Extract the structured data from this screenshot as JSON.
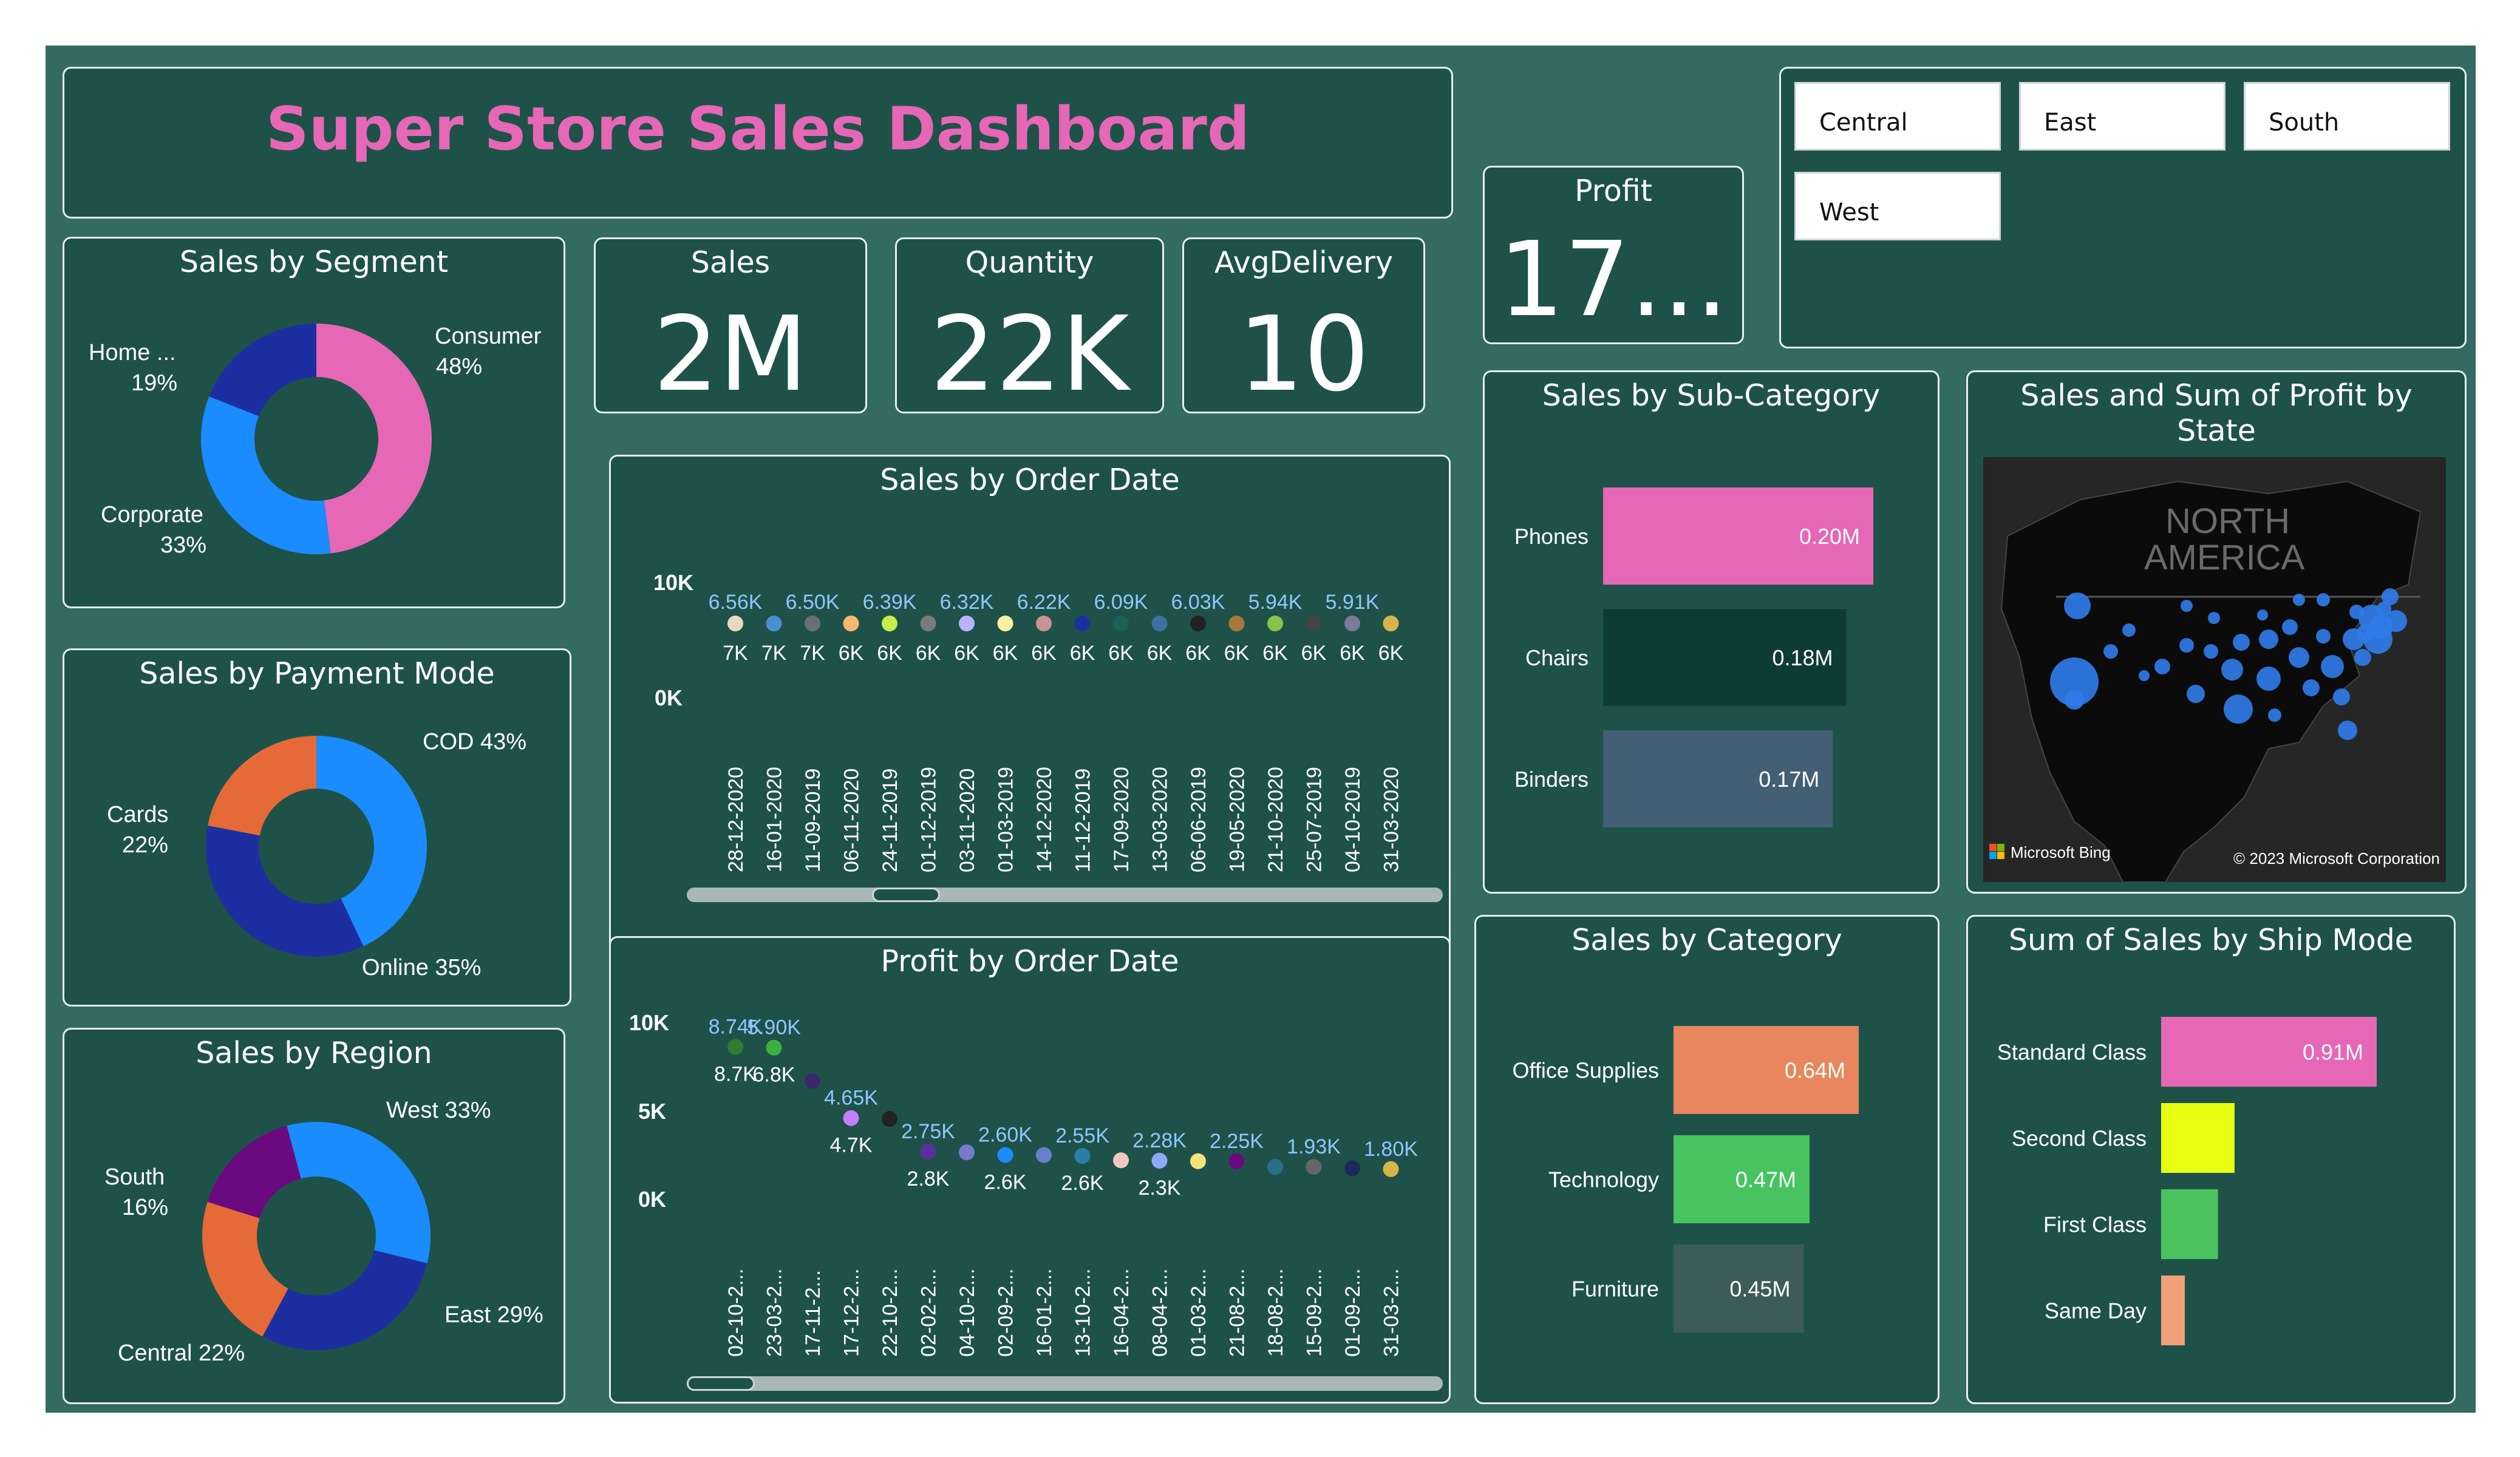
{
  "header": {
    "title": "Super Store Sales Dashboard"
  },
  "kpis": {
    "profit": {
      "label": "Profit",
      "value": "17..."
    },
    "sales": {
      "label": "Sales",
      "value": "2M"
    },
    "quantity": {
      "label": "Quantity",
      "value": "22K"
    },
    "avg_delivery": {
      "label": "AvgDelivery",
      "value": "10"
    }
  },
  "slicer": {
    "items": [
      "Central",
      "East",
      "South",
      "West"
    ]
  },
  "colors": {
    "canvas": "#336a62",
    "card": "#1e5249",
    "accent_pink": "#e667b5",
    "blue": "#1a8cff",
    "navy": "#1d2fa0",
    "orange": "#e56a38"
  },
  "segment": {
    "title": "Sales by Segment",
    "slices": [
      {
        "label": "Consumer",
        "pct": "48%",
        "value": 48,
        "color": "#e667b5"
      },
      {
        "label": "Corporate",
        "pct": "33%",
        "value": 33,
        "color": "#1a8cff"
      },
      {
        "label": "Home ...",
        "pct": "19%",
        "value": 19,
        "color": "#1d2fa0"
      }
    ]
  },
  "payment": {
    "title": "Sales by Payment Mode",
    "slices": [
      {
        "label": "COD 43%",
        "value": 43,
        "color": "#1a8cff"
      },
      {
        "label": "Online 35%",
        "value": 35,
        "color": "#1d2fa0"
      },
      {
        "label": "Cards",
        "pct": "22%",
        "value": 22,
        "color": "#e56a38"
      }
    ]
  },
  "region": {
    "title": "Sales by Region",
    "slices": [
      {
        "label": "West 33%",
        "value": 33,
        "color": "#1a8cff"
      },
      {
        "label": "East 29%",
        "value": 29,
        "color": "#1d2fa0"
      },
      {
        "label": "Central 22%",
        "value": 22,
        "color": "#e56a38"
      },
      {
        "label": "South",
        "pct": "16%",
        "value": 16,
        "color": "#6b0a7e"
      }
    ]
  },
  "sales_by_date": {
    "title": "Sales by Order Date",
    "y_ticks": [
      "10K",
      "0K"
    ],
    "dates": [
      "28-12-2020",
      "16-01-2020",
      "11-09-2019",
      "06-11-2020",
      "24-11-2019",
      "01-12-2019",
      "03-11-2020",
      "01-03-2019",
      "14-12-2020",
      "11-12-2019",
      "17-09-2020",
      "13-03-2020",
      "06-06-2019",
      "19-05-2020",
      "21-10-2020",
      "25-07-2019",
      "04-10-2019",
      "31-03-2020"
    ],
    "upper_labels": [
      "6.56K",
      "",
      "6.50K",
      "",
      "6.39K",
      "",
      "6.32K",
      "",
      "6.22K",
      "",
      "6.09K",
      "",
      "6.03K",
      "",
      "5.94K",
      "",
      "5.91K",
      ""
    ],
    "lower_labels": [
      "7K",
      "7K",
      "7K",
      "6K",
      "6K",
      "6K",
      "6K",
      "6K",
      "6K",
      "6K",
      "6K",
      "6K",
      "6K",
      "6K",
      "6K",
      "6K",
      "6K",
      "6K"
    ],
    "dot_colors": [
      "#e9d9c2",
      "#4a8fd0",
      "#6b6f72",
      "#f4b86f",
      "#c6ed4a",
      "#7a7a7a",
      "#b7b3ff",
      "#fff0a0",
      "#c79393",
      "#1d2fa0",
      "#1e5f5a",
      "#3f6ea0",
      "#222222",
      "#a8773f",
      "#8bc34a",
      "#444444",
      "#7a7a99",
      "#d9b44a"
    ]
  },
  "profit_by_date": {
    "title": "Profit by Order Date",
    "y_ticks": [
      "10K",
      "5K",
      "0K"
    ],
    "dates": [
      "02-10-2...",
      "23-03-2...",
      "17-11-2...",
      "17-12-2...",
      "22-10-2...",
      "02-02-2...",
      "04-10-2...",
      "02-09-2...",
      "16-01-2...",
      "13-10-2...",
      "16-04-2...",
      "08-04-2...",
      "01-03-2...",
      "21-08-2...",
      "18-08-2...",
      "15-09-2...",
      "01-09-2...",
      "31-03-2..."
    ],
    "upper_labels": [
      "8.74K",
      "5.90K",
      "",
      "4.65K",
      "",
      "2.75K",
      "",
      "2.60K",
      "",
      "2.55K",
      "",
      "2.28K",
      "",
      "2.25K",
      "",
      "1.93K",
      "",
      "1.80K"
    ],
    "lower_labels": [
      "8.7K",
      "6.8K",
      "",
      "4.7K",
      "",
      "2.8K",
      "",
      "2.6K",
      "",
      "2.6K",
      "",
      "2.3K",
      "",
      "",
      "",
      "",
      "",
      ""
    ],
    "values": [
      8740,
      8700,
      6800,
      4700,
      4650,
      2800,
      2750,
      2600,
      2600,
      2550,
      2300,
      2280,
      2250,
      2250,
      1930,
      1930,
      1850,
      1800
    ],
    "dot_colors": [
      "#2e7d32",
      "#3cb043",
      "#3a2a6a",
      "#c77dff",
      "#222222",
      "#5a2ea0",
      "#7a7acc",
      "#1a8cff",
      "#6a7fc9",
      "#2a7fa8",
      "#f3c6c6",
      "#8fa8ff",
      "#f5e27a",
      "#6b0a7e",
      "#2a6f8a",
      "#666666",
      "#1a2a5a",
      "#d9b44a"
    ]
  },
  "subcategory": {
    "title": "Sales by Sub-Category",
    "bars": [
      {
        "label": "Phones",
        "value": 0.2,
        "text": "0.20M",
        "color": "#e667b5"
      },
      {
        "label": "Chairs",
        "value": 0.18,
        "text": "0.18M",
        "color": "#0e3b35"
      },
      {
        "label": "Binders",
        "value": 0.17,
        "text": "0.17M",
        "color": "#435f74"
      }
    ]
  },
  "category": {
    "title": "Sales by Category",
    "bars": [
      {
        "label": "Office Supplies",
        "value": 0.64,
        "text": "0.64M",
        "color": "#e8865e"
      },
      {
        "label": "Technology",
        "value": 0.47,
        "text": "0.47M",
        "color": "#47c360"
      },
      {
        "label": "Furniture",
        "value": 0.45,
        "text": "0.45M",
        "color": "#3d5c57"
      }
    ]
  },
  "shipmode": {
    "title": "Sum of Sales by Ship Mode",
    "bars": [
      {
        "label": "Standard Class",
        "value": 0.91,
        "text": "0.91M",
        "color": "#e667b5"
      },
      {
        "label": "Second Class",
        "value": 0.31,
        "text": "",
        "color": "#e8ff14"
      },
      {
        "label": "First Class",
        "value": 0.24,
        "text": "",
        "color": "#4cc25f"
      },
      {
        "label": "Same Day",
        "value": 0.1,
        "text": "",
        "color": "#f0a07a"
      }
    ]
  },
  "map": {
    "title": "Sales and Sum of Profit by State",
    "region_label_1": "NORTH",
    "region_label_2": "AMERICA",
    "provider": "Microsoft Bing",
    "copyright": "© 2023 Microsoft Corporation"
  },
  "chart_data": [
    {
      "type": "pie",
      "title": "Sales by Segment",
      "categories": [
        "Consumer",
        "Corporate",
        "Home ..."
      ],
      "values": [
        48,
        33,
        19
      ]
    },
    {
      "type": "pie",
      "title": "Sales by Payment Mode",
      "categories": [
        "COD",
        "Online",
        "Cards"
      ],
      "values": [
        43,
        35,
        22
      ]
    },
    {
      "type": "pie",
      "title": "Sales by Region",
      "categories": [
        "West",
        "East",
        "Central",
        "South"
      ],
      "values": [
        33,
        29,
        22,
        16
      ]
    },
    {
      "type": "bar",
      "title": "Sales by Sub-Category",
      "categories": [
        "Phones",
        "Chairs",
        "Binders"
      ],
      "values": [
        0.2,
        0.18,
        0.17
      ]
    },
    {
      "type": "bar",
      "title": "Sales by Category",
      "categories": [
        "Office Supplies",
        "Technology",
        "Furniture"
      ],
      "values": [
        0.64,
        0.47,
        0.45
      ]
    },
    {
      "type": "bar",
      "title": "Sum of Sales by Ship Mode",
      "categories": [
        "Standard Class",
        "Second Class",
        "First Class",
        "Same Day"
      ],
      "values": [
        0.91,
        0.31,
        0.24,
        0.1
      ]
    }
  ]
}
